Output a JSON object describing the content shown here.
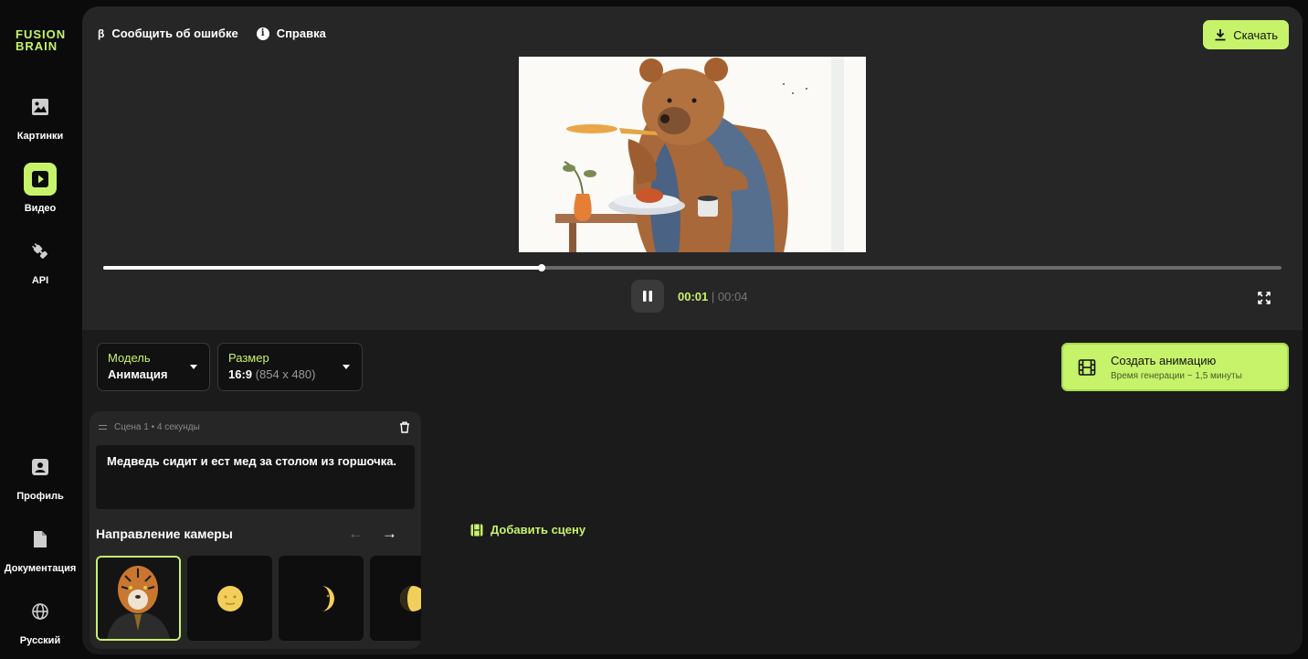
{
  "brand": {
    "line1": "FUSION",
    "line2": "BRAIN",
    "accent": "#c7f36b"
  },
  "sidebar": {
    "items": [
      {
        "label": "Картинки",
        "icon": "image-icon"
      },
      {
        "label": "Видео",
        "icon": "play-icon",
        "active": true
      },
      {
        "label": "API",
        "icon": "plug-icon"
      },
      {
        "label": "Профиль",
        "icon": "profile-icon"
      },
      {
        "label": "Документация",
        "icon": "document-icon"
      },
      {
        "label": "Русский",
        "icon": "globe-icon"
      }
    ]
  },
  "header": {
    "report_icon": "β",
    "report_label": "Сообщить об ошибке",
    "help_icon": "i",
    "help_label": "Справка",
    "download_label": "Скачать"
  },
  "player": {
    "current_time": "00:01",
    "separator": "|",
    "total_time": "00:04",
    "progress": 0.372
  },
  "settings": {
    "model_label": "Модель",
    "model_value": "Анимация",
    "size_label": "Размер",
    "size_ratio": "16:9",
    "size_resolution": "(854 x 480)"
  },
  "create": {
    "title": "Создать анимацию",
    "subtitle": "Время генерации ~ 1,5 минуты"
  },
  "scene": {
    "header": "Сцена 1 • 4 секунды",
    "prompt": "Медведь сидит и ест мед за столом из горшочка.",
    "camera_title": "Направление камеры"
  },
  "add_scene_label": "Добавить сцену"
}
